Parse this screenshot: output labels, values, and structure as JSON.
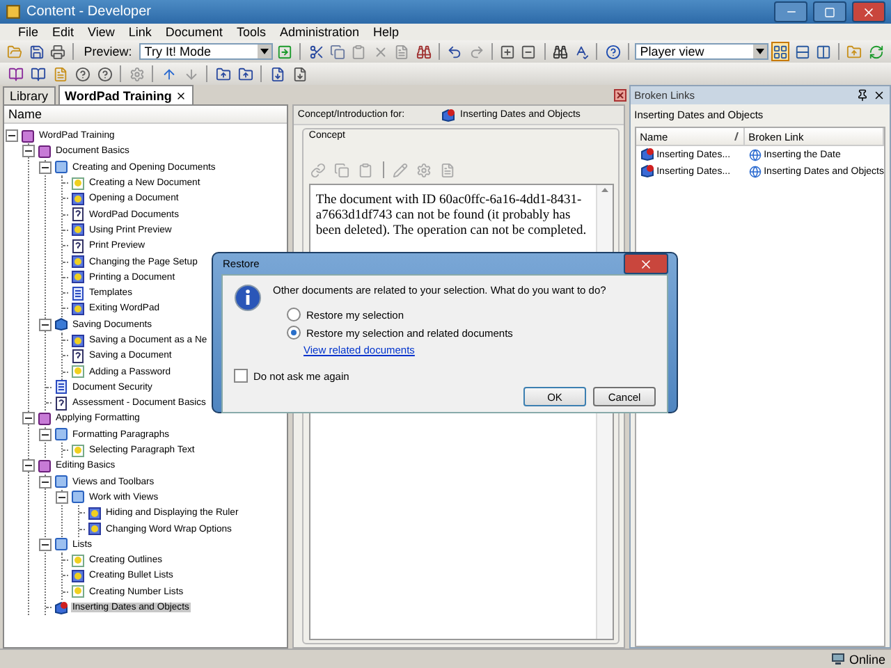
{
  "window": {
    "title": "Content - Developer"
  },
  "menu": [
    "File",
    "Edit",
    "View",
    "Link",
    "Document",
    "Tools",
    "Administration",
    "Help"
  ],
  "toolbar": {
    "preview_label": "Preview:",
    "preview_mode": "Try It! Mode",
    "view_mode": "Player view"
  },
  "tabs": [
    {
      "label": "Library",
      "selected": false
    },
    {
      "label": "WordPad Training",
      "selected": true
    }
  ],
  "tree": {
    "header": "Name",
    "items": [
      {
        "label": "WordPad Training",
        "kind": "book",
        "selected": false,
        "expanded": true,
        "children": [
          {
            "label": "Document Basics",
            "kind": "book",
            "selected": false,
            "expanded": true,
            "children": [
              {
                "label": "Creating and Opening Documents",
                "kind": "module",
                "selected": false,
                "expanded": true,
                "children": [
                  {
                    "label": "Creating a New Document",
                    "kind": "topic",
                    "selected": false
                  },
                  {
                    "label": "Opening a Document",
                    "kind": "practice",
                    "selected": false
                  },
                  {
                    "label": "WordPad Documents",
                    "kind": "question",
                    "selected": false
                  },
                  {
                    "label": "Using Print Preview",
                    "kind": "practice",
                    "selected": false
                  },
                  {
                    "label": "Print Preview",
                    "kind": "question",
                    "selected": false
                  },
                  {
                    "label": "Changing the Page Setup",
                    "kind": "practice",
                    "selected": false
                  },
                  {
                    "label": "Printing a Document",
                    "kind": "practice",
                    "selected": false
                  },
                  {
                    "label": "Templates",
                    "kind": "page",
                    "selected": false
                  },
                  {
                    "label": "Exiting WordPad",
                    "kind": "practice",
                    "selected": false
                  }
                ]
              },
              {
                "label": "Saving Documents",
                "kind": "section",
                "selected": false,
                "expanded": true,
                "children": [
                  {
                    "label": "Saving a Document as a Ne",
                    "kind": "practice",
                    "selected": false
                  },
                  {
                    "label": "Saving a Document",
                    "kind": "question",
                    "selected": false
                  },
                  {
                    "label": "Adding a Password",
                    "kind": "topic",
                    "selected": false
                  }
                ]
              },
              {
                "label": "Document Security",
                "kind": "page",
                "selected": false
              },
              {
                "label": "Assessment - Document Basics",
                "kind": "question",
                "selected": false
              }
            ]
          },
          {
            "label": "Applying Formatting",
            "kind": "book",
            "selected": false,
            "expanded": true,
            "children": [
              {
                "label": "Formatting Paragraphs",
                "kind": "module",
                "selected": false,
                "expanded": true,
                "children": [
                  {
                    "label": "Selecting Paragraph Text",
                    "kind": "topic",
                    "selected": false
                  }
                ]
              }
            ]
          },
          {
            "label": "Editing Basics",
            "kind": "book",
            "selected": false,
            "expanded": true,
            "children": [
              {
                "label": "Views and Toolbars",
                "kind": "module",
                "selected": false,
                "expanded": true,
                "children": [
                  {
                    "label": "Work with Views",
                    "kind": "module",
                    "selected": false,
                    "expanded": true,
                    "children": [
                      {
                        "label": "Hiding and Displaying the Ruler",
                        "kind": "practice",
                        "selected": false
                      },
                      {
                        "label": "Changing Word Wrap Options",
                        "kind": "practice",
                        "selected": false
                      }
                    ]
                  }
                ]
              },
              {
                "label": "Lists",
                "kind": "module",
                "selected": false,
                "expanded": true,
                "children": [
                  {
                    "label": "Creating Outlines",
                    "kind": "topic",
                    "selected": false
                  },
                  {
                    "label": "Creating Bullet Lists",
                    "kind": "practice",
                    "selected": false
                  },
                  {
                    "label": "Creating Number Lists",
                    "kind": "topic",
                    "selected": false
                  }
                ]
              },
              {
                "label": "Inserting Dates and Objects",
                "kind": "broken",
                "selected": true
              }
            ]
          }
        ]
      }
    ]
  },
  "concept": {
    "header_label": "Concept/Introduction for:",
    "header_doc": "Inserting Dates and Objects",
    "group_label": "Concept",
    "text": "The document with ID 60ac0ffc-6a16-4dd1-8431-a7663d1df743 can not be found (it probably has been deleted). The operation can not be completed."
  },
  "broken_links": {
    "title": "Broken Links",
    "subtitle": "Inserting Dates and Objects",
    "columns": [
      "Name",
      "Broken Link"
    ],
    "rows": [
      {
        "name": "Inserting Dates...",
        "link": "Inserting the Date"
      },
      {
        "name": "Inserting Dates...",
        "link": "Inserting Dates and Objects"
      }
    ]
  },
  "dialog": {
    "title": "Restore",
    "message": "Other documents are related to your selection. What do you want to do?",
    "options": [
      {
        "label": "Restore my selection",
        "selected": false
      },
      {
        "label": "Restore my selection and related documents",
        "selected": true
      }
    ],
    "link": "View related documents",
    "dont_ask": {
      "label": "Do not ask me again",
      "checked": false
    },
    "buttons": [
      {
        "label": "OK",
        "default": true
      },
      {
        "label": "Cancel",
        "default": false
      }
    ]
  },
  "status_bar": {
    "text": "Online"
  }
}
